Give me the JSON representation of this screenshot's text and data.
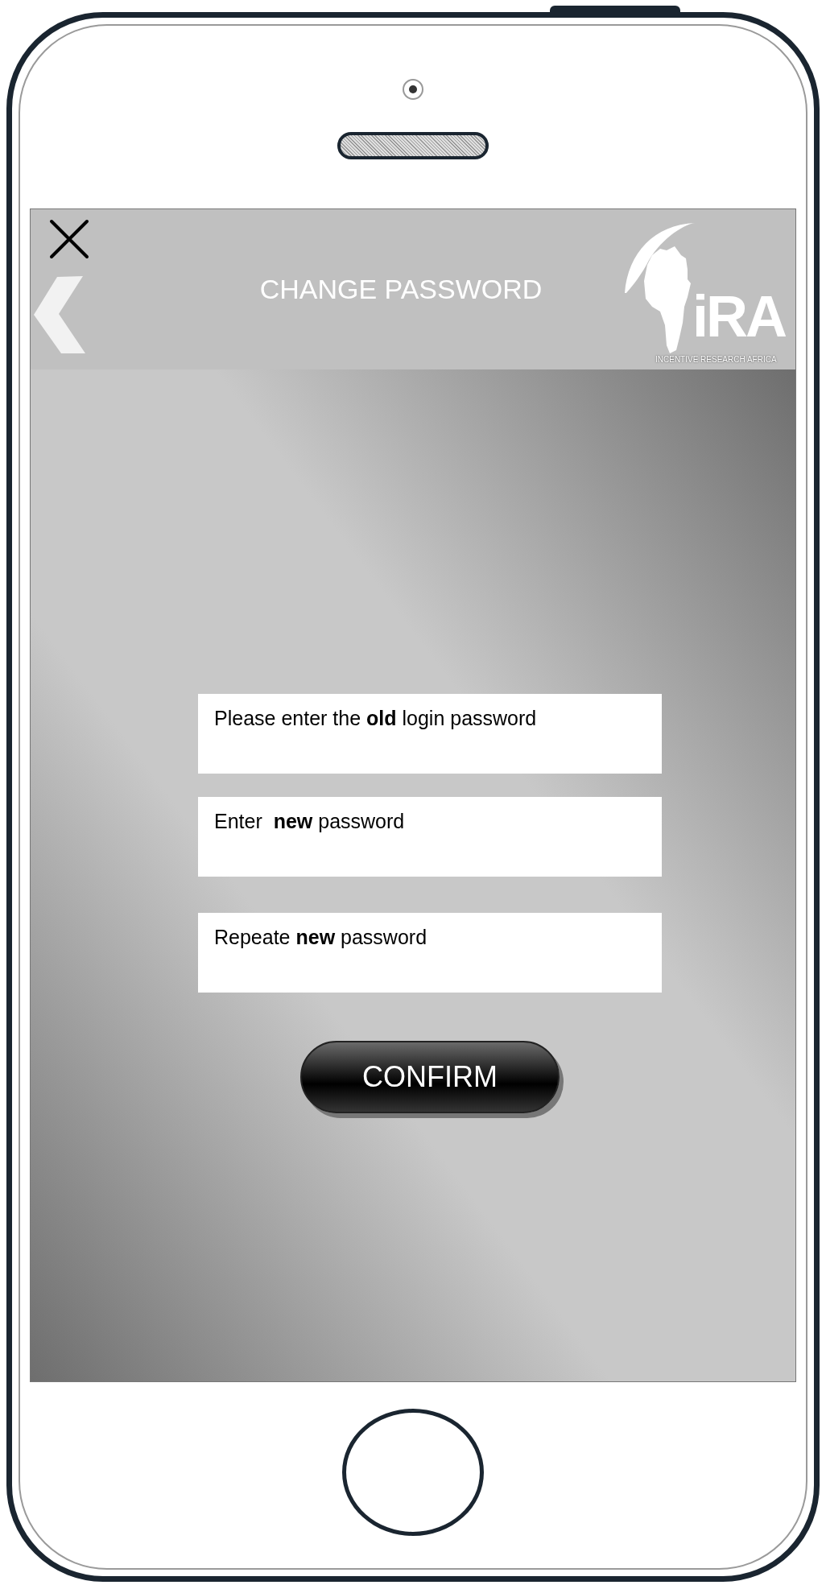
{
  "header": {
    "title": "CHANGE PASSWORD",
    "logo": {
      "wordmark": "iRA",
      "tagline": "INCENTIVE RESEARCH AFRICA"
    }
  },
  "fields": [
    {
      "label": "Please enter the **old** login password"
    },
    {
      "label": "Enter  **new** password"
    },
    {
      "label": "Repeate **new** password"
    }
  ],
  "confirm_button": {
    "label": "CONFIRM"
  }
}
